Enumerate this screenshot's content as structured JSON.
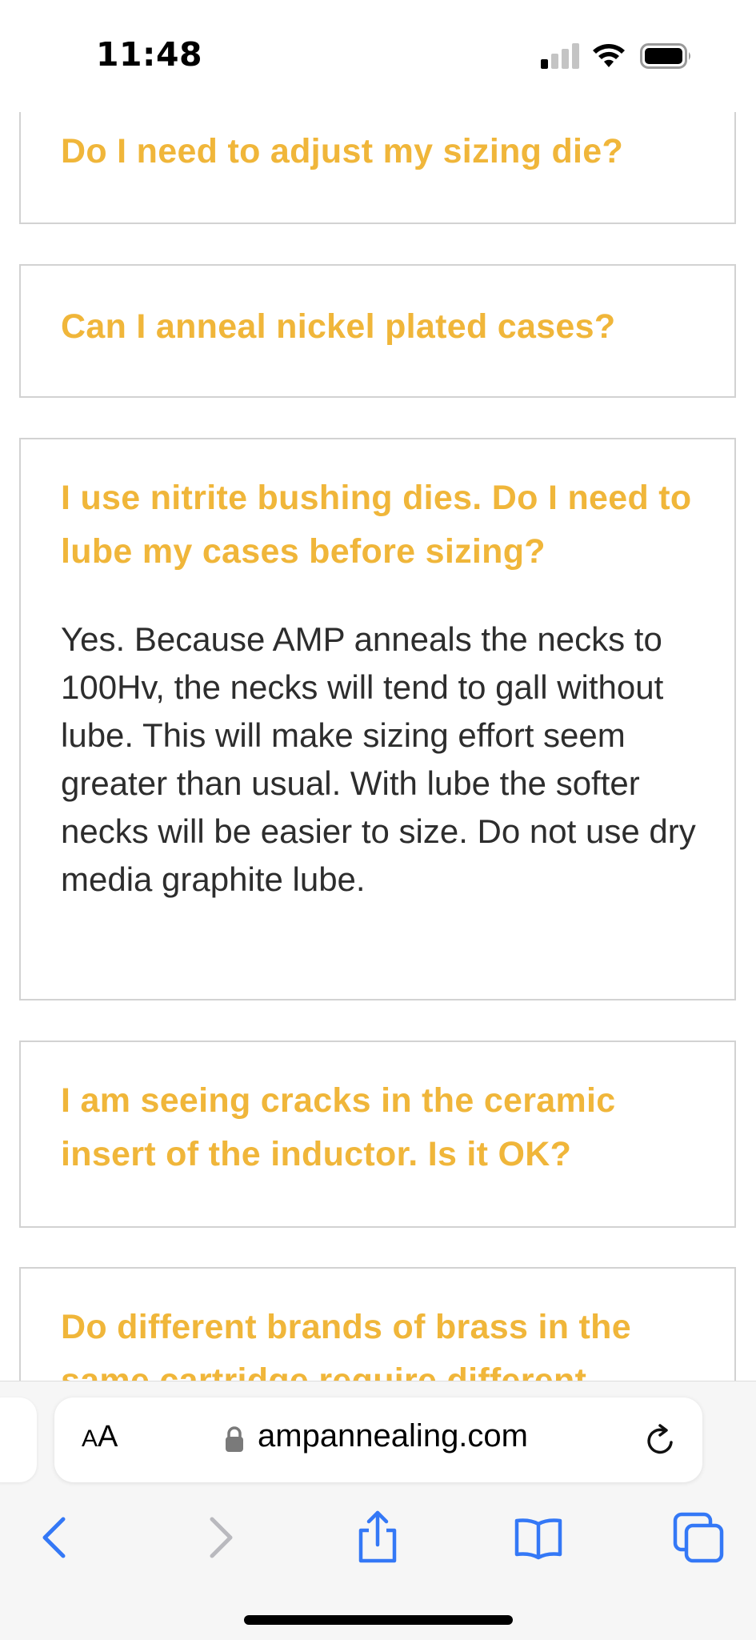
{
  "status_bar": {
    "time": "11:48"
  },
  "faq": {
    "items": [
      {
        "question": "Do I need to adjust my sizing die?"
      },
      {
        "question": "Can I anneal nickel plated cases?"
      },
      {
        "question": "I use nitrite bushing dies. Do I need to lube my cases before sizing?",
        "answer": "Yes. Because AMP anneals the necks to 100Hv, the necks will tend to gall without lube. This will make sizing effort seem greater than usual. With lube the softer necks will be easier to size. Do not use dry media graphite lube."
      },
      {
        "question": "I am seeing cracks in the ceramic insert of the inductor. Is it OK?"
      },
      {
        "question": "Do different brands of brass in the same cartridge require different"
      }
    ]
  },
  "browser": {
    "aa_label_large": "A",
    "aa_label_small": "A",
    "url": "ampannealing.com"
  },
  "colors": {
    "question_text": "#f0b63a",
    "answer_text": "#2d2d2d",
    "card_border": "#d2d2d2",
    "toolbar_accent": "#3478f6",
    "toolbar_disabled": "#b9b9be"
  },
  "icons": {
    "status": [
      "signal-icon",
      "wifi-icon",
      "battery-icon"
    ],
    "address_bar": [
      "lock-icon",
      "reload-icon"
    ],
    "toolbar": [
      "back-icon",
      "forward-icon",
      "share-icon",
      "bookmarks-icon",
      "tabs-icon"
    ]
  }
}
